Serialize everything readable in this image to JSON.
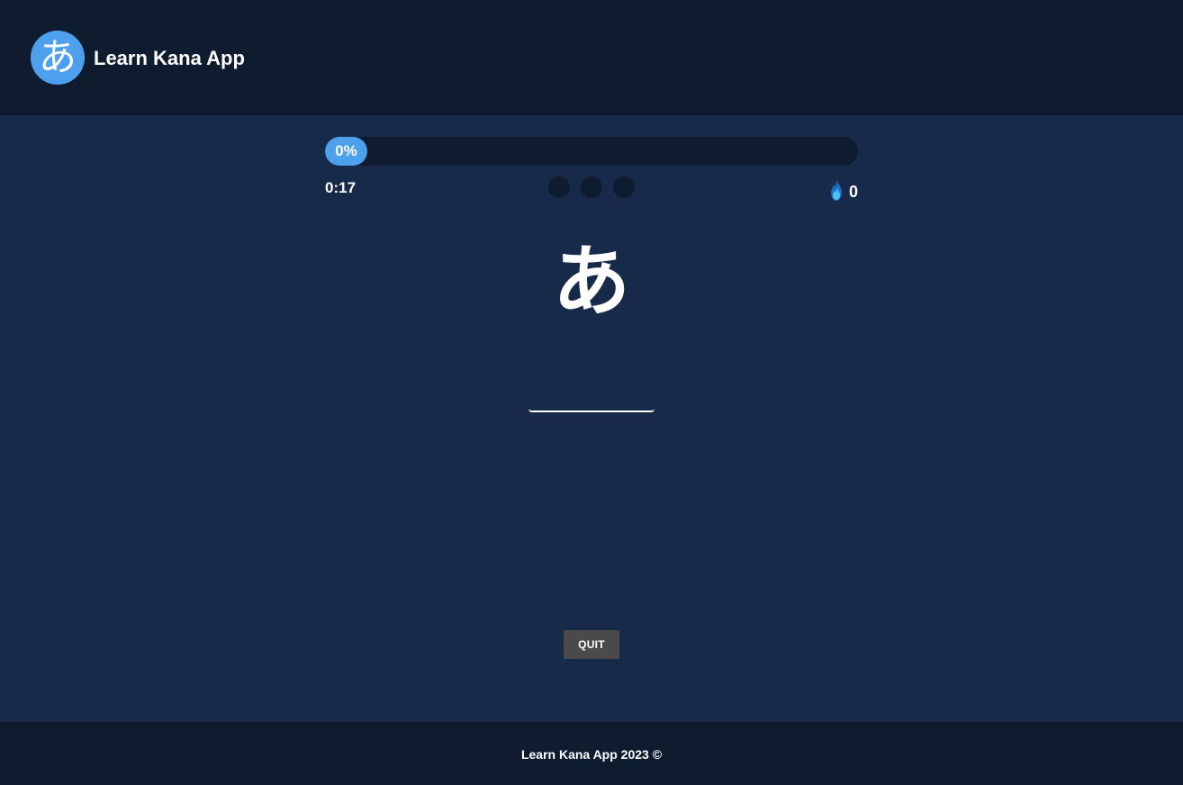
{
  "header": {
    "logo_char": "あ",
    "title": "Learn Kana App"
  },
  "quiz": {
    "progress": {
      "value_percent": 0,
      "label": "0%"
    },
    "timer": "0:17",
    "lives": [
      {
        "state": "empty"
      },
      {
        "state": "empty"
      },
      {
        "state": "empty"
      }
    ],
    "streak": {
      "icon": "flame-icon",
      "count": "0"
    },
    "kana": "あ",
    "answer": {
      "value": "",
      "placeholder": ""
    },
    "quit_label": "QUIT"
  },
  "footer": {
    "text": "Learn Kana App 2023 ©"
  },
  "colors": {
    "header_bg": "#0f1c30",
    "page_bg": "#172a49",
    "accent": "#4da0ec",
    "quit_bg": "#4a4a4a",
    "flame": "#2f8fe6"
  }
}
